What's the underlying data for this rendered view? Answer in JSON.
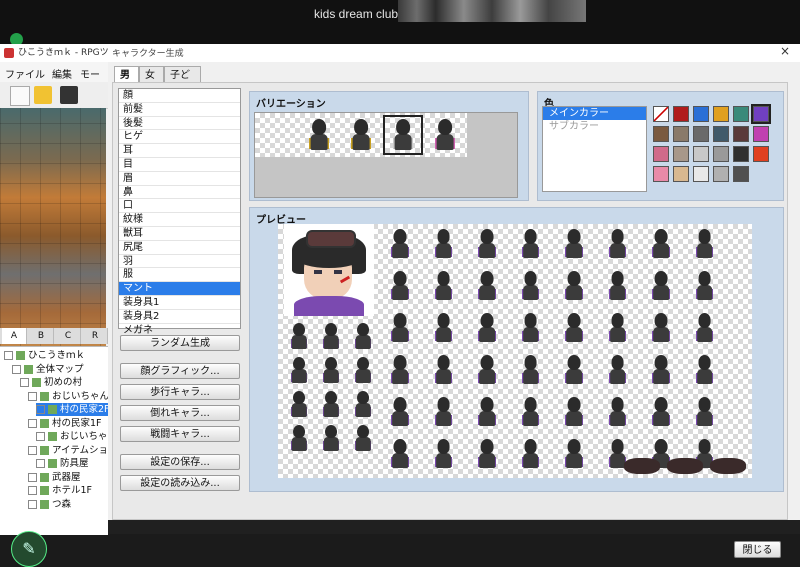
{
  "topbar": {
    "meeting_title": "kids dream club"
  },
  "bg_app": {
    "title": "ひこうきｍｋ - RPGツクール",
    "menu": [
      "ファイル",
      "編集",
      "モード"
    ],
    "tile_tabs": [
      "A",
      "B",
      "C",
      "R"
    ],
    "tree": [
      {
        "label": "ひこうきｍｋ",
        "indent": 0
      },
      {
        "label": "全体マップ",
        "indent": 1
      },
      {
        "label": "初めの村",
        "indent": 2
      },
      {
        "label": "おじいちゃんの",
        "indent": 3
      },
      {
        "label": "村の民家2F",
        "indent": 4,
        "selected": true
      },
      {
        "label": "村の民家1F",
        "indent": 3
      },
      {
        "label": "おじいちゃんの",
        "indent": 4
      },
      {
        "label": "アイテムショッ",
        "indent": 3
      },
      {
        "label": "防具屋",
        "indent": 4
      },
      {
        "label": "武器屋",
        "indent": 3
      },
      {
        "label": "ホテル1F",
        "indent": 3
      },
      {
        "label": "つ森",
        "indent": 3
      }
    ]
  },
  "dialog": {
    "title": "キャラクター生成",
    "close_x": "×",
    "tabs": [
      "男性",
      "女性",
      "子ども"
    ],
    "parts": [
      "顔",
      "前髪",
      "後髪",
      "ヒゲ",
      "耳",
      "目",
      "眉",
      "鼻",
      "口",
      "紋様",
      "獣耳",
      "尻尾",
      "羽",
      "服",
      "マント",
      "装身具1",
      "装身具2",
      "メガネ"
    ],
    "selected_part": "マント",
    "random_button": "ランダム生成",
    "output_buttons": [
      "顔グラフィック...",
      "歩行キャラ...",
      "倒れキャラ...",
      "戦闘キャラ..."
    ],
    "settings_buttons": [
      "設定の保存...",
      "設定の読み込み..."
    ],
    "variation_title": "バリエーション",
    "color_title": "色",
    "color_items": [
      "メインカラー",
      "サブカラー"
    ],
    "selected_color_item": "メインカラー",
    "swatches": [
      "none",
      "#b01c1c",
      "#2a6fd6",
      "#e0a020",
      "#3a8a7a",
      "#7040c0",
      "#7a5a40",
      "#8a7a6a",
      "#6a6a6a",
      "#405a6a",
      "#5a3a3a",
      "#c040b0",
      "#d06a8a",
      "#a8988a",
      "#c8c8c8",
      "#9a9a9a",
      "#303030",
      "#e04020",
      "#e88aa8",
      "#d8b890",
      "#e8e8e8",
      "#b0b0b0",
      "#505050"
    ],
    "selected_swatch": 5,
    "variation_selected": 3,
    "preview_title": "プレビュー",
    "close_button": "閉じる"
  }
}
